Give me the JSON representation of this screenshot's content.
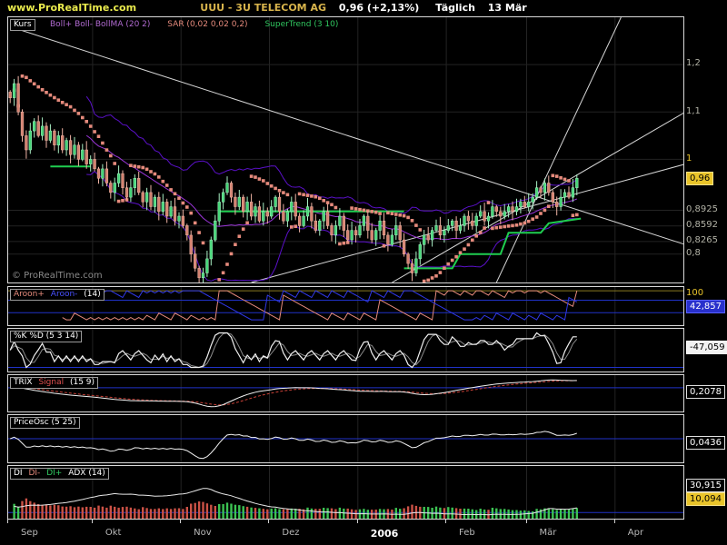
{
  "header": {
    "site": "www.ProRealTime.com",
    "symbol": "UUU - 3U TELECOM AG",
    "quote": "0,96 (+2,13%)",
    "period": "Täglich",
    "date": "13 Mär"
  },
  "watermark": "© ProRealTime.com",
  "panels": {
    "price": {
      "label": "Kurs",
      "legend": [
        "Boll+ Boll- BollMA (20 2)",
        "SAR (0,02 0,02 0,2)",
        "SuperTrend (3 10)"
      ]
    },
    "aroon": {
      "legend": [
        "Aroon+",
        "Aroon-",
        "(14)"
      ]
    },
    "stoch": {
      "label": "%K %D (5 3 14)"
    },
    "trix": {
      "legend": [
        "TRIX",
        "Signal",
        "(15 9)"
      ]
    },
    "priceosc": {
      "label": "PriceOsc (5 25)"
    },
    "dmi": {
      "legend": [
        "DI",
        "DI-",
        "DI+",
        "ADX (14)"
      ]
    }
  },
  "axis_values": {
    "price": [
      "1,2",
      "1,1",
      "1",
      "0,96",
      "0,8925",
      "0,8592",
      "0,8265",
      "0,8"
    ],
    "aroon": [
      "100",
      "42,857"
    ],
    "stoch": "-47,059",
    "trix": "0,2078",
    "priceosc": "0,0436",
    "dmi": [
      "30,915",
      "10,094"
    ]
  },
  "chart_data": [
    {
      "type": "candlestick",
      "title": "Kurs (UUU - 3U TELECOM AG, Täglich)",
      "ylim": [
        0.74,
        1.3
      ],
      "x_domain": 168,
      "last_price": 0.96,
      "months": [
        {
          "label": "Sep",
          "start": 0
        },
        {
          "label": "Okt",
          "start": 21
        },
        {
          "label": "Nov",
          "start": 43
        },
        {
          "label": "Dez",
          "start": 65
        },
        {
          "label": "2006",
          "start": 87,
          "bold": true
        },
        {
          "label": "Feb",
          "start": 109
        },
        {
          "label": "Mär",
          "start": 129
        },
        {
          "label": "Apr",
          "start": 151
        }
      ],
      "closes": [
        1.13,
        1.16,
        1.1,
        1.05,
        1.02,
        1.06,
        1.08,
        1.05,
        1.07,
        1.04,
        1.06,
        1.03,
        1.05,
        1.02,
        1.04,
        1.01,
        1.03,
        1.0,
        1.02,
        0.99,
        1.0,
        0.98,
        0.96,
        0.98,
        0.95,
        0.93,
        0.95,
        0.97,
        0.94,
        0.92,
        0.94,
        0.96,
        0.93,
        0.91,
        0.93,
        0.9,
        0.92,
        0.89,
        0.91,
        0.88,
        0.9,
        0.87,
        0.88,
        0.86,
        0.84,
        0.8,
        0.77,
        0.75,
        0.76,
        0.79,
        0.83,
        0.87,
        0.91,
        0.93,
        0.95,
        0.92,
        0.9,
        0.92,
        0.89,
        0.91,
        0.88,
        0.9,
        0.87,
        0.89,
        0.88,
        0.9,
        0.92,
        0.89,
        0.87,
        0.89,
        0.91,
        0.88,
        0.86,
        0.88,
        0.9,
        0.87,
        0.85,
        0.87,
        0.89,
        0.86,
        0.84,
        0.86,
        0.88,
        0.85,
        0.83,
        0.85,
        0.84,
        0.86,
        0.88,
        0.85,
        0.83,
        0.85,
        0.87,
        0.84,
        0.82,
        0.84,
        0.86,
        0.83,
        0.8,
        0.78,
        0.76,
        0.79,
        0.82,
        0.84,
        0.83,
        0.85,
        0.86,
        0.84,
        0.85,
        0.86,
        0.87,
        0.85,
        0.86,
        0.88,
        0.87,
        0.86,
        0.88,
        0.89,
        0.87,
        0.88,
        0.9,
        0.89,
        0.88,
        0.89,
        0.9,
        0.89,
        0.9,
        0.91,
        0.9,
        0.91,
        0.92,
        0.94,
        0.93,
        0.95,
        0.93,
        0.91,
        0.9,
        0.92,
        0.93,
        0.92,
        0.94,
        0.96
      ],
      "grid_levels": [
        1.2,
        1.1,
        1.0,
        0.8925,
        0.8592,
        0.8265,
        0.8
      ],
      "trend_lines": [
        [
          [
            0,
            1.28
          ],
          [
            168,
            0.82
          ]
        ],
        [
          [
            121,
            0.74
          ],
          [
            152,
            1.3
          ]
        ],
        [
          [
            95,
            0.74
          ],
          [
            168,
            1.1
          ]
        ],
        [
          [
            60,
            0.74
          ],
          [
            168,
            0.99
          ]
        ]
      ],
      "supertrend": [
        [
          [
            10,
            0.985
          ],
          [
            20,
            0.985
          ]
        ],
        [
          [
            52,
            0.89
          ],
          [
            98,
            0.89
          ]
        ],
        [
          [
            98,
            0.77
          ],
          [
            110,
            0.77
          ],
          [
            112,
            0.8
          ],
          [
            122,
            0.8
          ],
          [
            124,
            0.845
          ],
          [
            132,
            0.845
          ],
          [
            134,
            0.865
          ],
          [
            142,
            0.875
          ]
        ]
      ],
      "indicators": {
        "bollinger": [
          20,
          2
        ],
        "sar": [
          0.02,
          0.02,
          0.2
        ],
        "supertrend": [
          3,
          10
        ]
      }
    },
    {
      "type": "line",
      "name": "Aroon",
      "params": [
        14
      ],
      "ylim": [
        -10,
        112
      ],
      "h_lines": [
        30,
        70,
        100
      ],
      "axis_values": [
        100,
        42.857
      ]
    },
    {
      "type": "line",
      "name": "Stochastic %K %D",
      "params": [
        5,
        3,
        14
      ],
      "ylim": [
        -12,
        112
      ],
      "h_lines": [
        0
      ],
      "axis_value": -47.059
    },
    {
      "type": "line",
      "name": "TRIX Signal",
      "params": [
        15,
        9
      ],
      "h_lines": [
        0
      ],
      "axis_value": 0.2078
    },
    {
      "type": "line",
      "name": "PriceOsc",
      "params": [
        5,
        25
      ],
      "h_lines": [
        0
      ],
      "axis_value": 0.0436
    },
    {
      "type": "dmi",
      "name": "DI DI- DI+ ADX",
      "params": [
        14
      ],
      "ylim": [
        0,
        85
      ],
      "h_lines": [
        10
      ],
      "axis_values": [
        30.915,
        10.094
      ]
    }
  ]
}
